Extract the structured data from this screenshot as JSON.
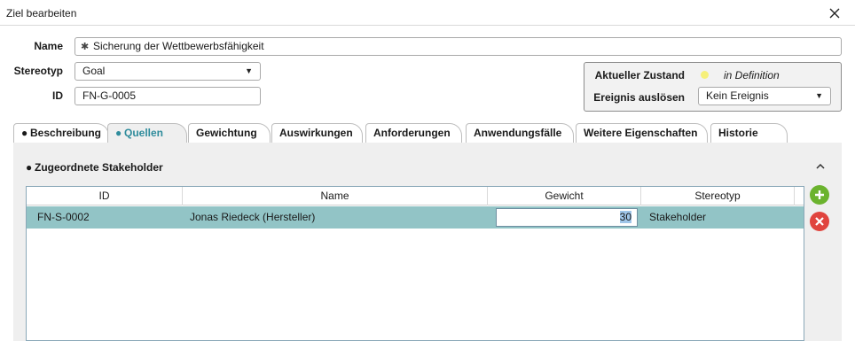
{
  "window": {
    "title": "Ziel bearbeiten"
  },
  "form": {
    "name_label": "Name",
    "name_value": "Sicherung der Wettbewerbsfähigkeit",
    "name_marker": "✱",
    "stereotype_label": "Stereotyp",
    "stereotype_value": "Goal",
    "id_label": "ID",
    "id_value": "FN-G-0005"
  },
  "status": {
    "current_label": "Aktueller Zustand",
    "current_value": "in Definition",
    "current_color": "#f6f07a",
    "event_label": "Ereignis auslösen",
    "event_value": "Kein Ereignis"
  },
  "tabs": [
    {
      "label": "Beschreibung",
      "bullet": "●"
    },
    {
      "label": "Quellen",
      "bullet": "●",
      "active": true
    },
    {
      "label": "Gewichtung"
    },
    {
      "label": "Auswirkungen"
    },
    {
      "label": "Anforderungen"
    },
    {
      "label": "Anwendungsfälle"
    },
    {
      "label": "Weitere Eigenschaften"
    },
    {
      "label": "Historie"
    }
  ],
  "section": {
    "title": "Zugeordnete Stakeholder",
    "bullet": "●"
  },
  "table": {
    "columns": [
      "ID",
      "Name",
      "Gewicht",
      "Stereotyp"
    ],
    "rows": [
      {
        "id": "FN-S-0002",
        "name": "Jonas Riedeck (Hersteller)",
        "weight": "30",
        "stereotype": "Stakeholder"
      }
    ]
  },
  "colors": {
    "accent": "#2f8c9c",
    "selected_row": "#92c4c6",
    "add": "#6bb32e",
    "remove": "#e0443e"
  },
  "icons": {
    "close": "close-icon",
    "collapse": "chevron-up-icon",
    "add": "add-circle-icon",
    "remove": "remove-circle-icon"
  }
}
